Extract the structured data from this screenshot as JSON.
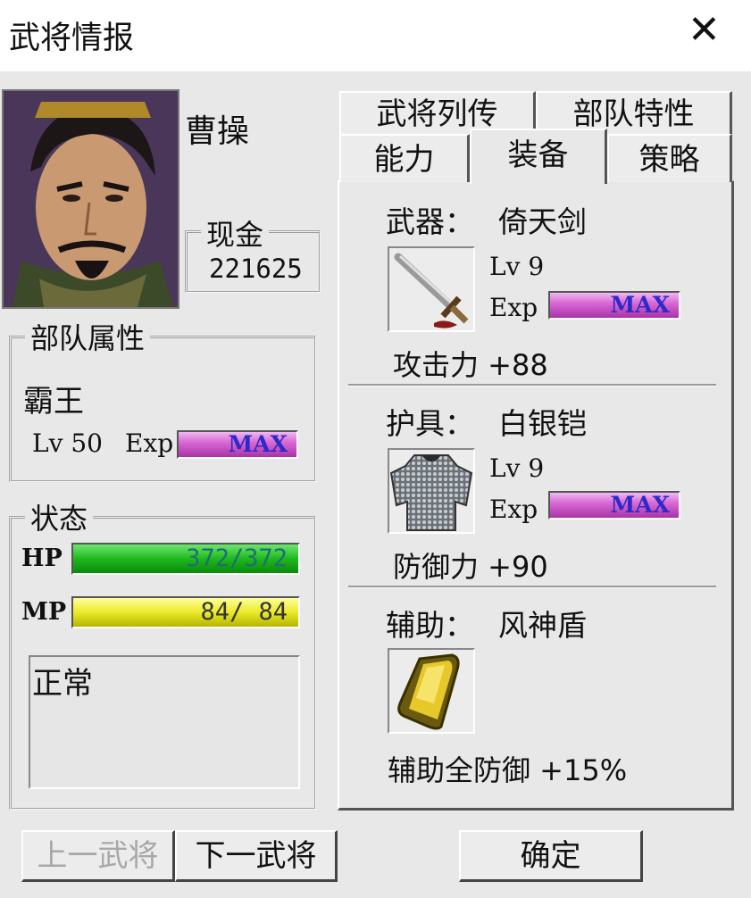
{
  "window": {
    "title": "武将情报",
    "close_glyph": "✕"
  },
  "general": {
    "name": "曹操"
  },
  "money": {
    "label": "现金",
    "value": "221625"
  },
  "troop": {
    "label": "部队属性",
    "name": "霸王",
    "lv": "Lv 50",
    "exp_label": "Exp",
    "exp_value": "MAX"
  },
  "status": {
    "label": "状态",
    "hp_label": "HP",
    "hp_value": "372/372",
    "hp_fraction": 1.0,
    "mp_label": "MP",
    "mp_value": "84/ 84",
    "mp_fraction": 1.0,
    "condition": "正常"
  },
  "tabs": [
    "武将列传",
    "部队特性",
    "能力",
    "装备",
    "策略"
  ],
  "active_tab": "装备",
  "equipment": {
    "weapon": {
      "slot": "武器：",
      "name": "倚天剑",
      "lv": "Lv  9",
      "exp_label": "Exp",
      "exp_value": "MAX",
      "stat": "攻击力 +88"
    },
    "armor": {
      "slot": "护具：",
      "name": "白银铠",
      "lv": "Lv  9",
      "exp_label": "Exp",
      "exp_value": "MAX",
      "stat": "防御力 +90"
    },
    "accessory": {
      "slot": "辅助：",
      "name": "风神盾",
      "stat": "辅助全防御 +15%"
    }
  },
  "buttons": {
    "prev": "上一武将",
    "next": "下一武将",
    "ok": "确定"
  },
  "colors": {
    "hp_bar": "#1fb81f",
    "mp_bar": "#eaea2a",
    "exp_bar": "#d96ad6",
    "exp_text": "#2c2ac8"
  }
}
